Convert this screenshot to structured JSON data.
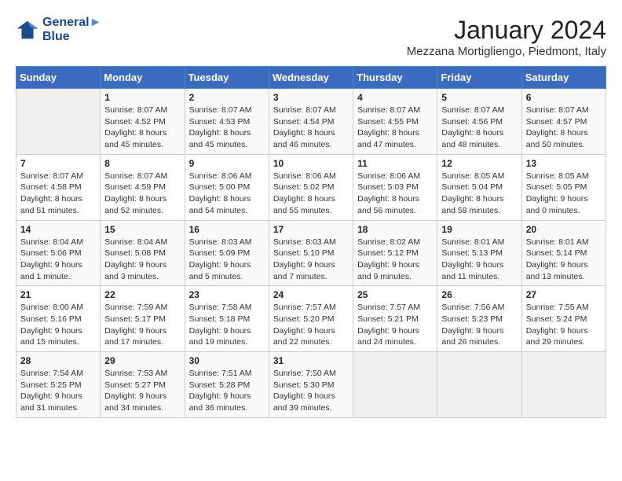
{
  "logo": {
    "line1": "General",
    "line2": "Blue"
  },
  "title": "January 2024",
  "location": "Mezzana Mortigliengo, Piedmont, Italy",
  "headers": [
    "Sunday",
    "Monday",
    "Tuesday",
    "Wednesday",
    "Thursday",
    "Friday",
    "Saturday"
  ],
  "weeks": [
    [
      {
        "day": "",
        "info": ""
      },
      {
        "day": "1",
        "info": "Sunrise: 8:07 AM\nSunset: 4:52 PM\nDaylight: 8 hours\nand 45 minutes."
      },
      {
        "day": "2",
        "info": "Sunrise: 8:07 AM\nSunset: 4:53 PM\nDaylight: 8 hours\nand 45 minutes."
      },
      {
        "day": "3",
        "info": "Sunrise: 8:07 AM\nSunset: 4:54 PM\nDaylight: 8 hours\nand 46 minutes."
      },
      {
        "day": "4",
        "info": "Sunrise: 8:07 AM\nSunset: 4:55 PM\nDaylight: 8 hours\nand 47 minutes."
      },
      {
        "day": "5",
        "info": "Sunrise: 8:07 AM\nSunset: 4:56 PM\nDaylight: 8 hours\nand 48 minutes."
      },
      {
        "day": "6",
        "info": "Sunrise: 8:07 AM\nSunset: 4:57 PM\nDaylight: 8 hours\nand 50 minutes."
      }
    ],
    [
      {
        "day": "7",
        "info": "Sunrise: 8:07 AM\nSunset: 4:58 PM\nDaylight: 8 hours\nand 51 minutes."
      },
      {
        "day": "8",
        "info": "Sunrise: 8:07 AM\nSunset: 4:59 PM\nDaylight: 8 hours\nand 52 minutes."
      },
      {
        "day": "9",
        "info": "Sunrise: 8:06 AM\nSunset: 5:00 PM\nDaylight: 8 hours\nand 54 minutes."
      },
      {
        "day": "10",
        "info": "Sunrise: 8:06 AM\nSunset: 5:02 PM\nDaylight: 8 hours\nand 55 minutes."
      },
      {
        "day": "11",
        "info": "Sunrise: 8:06 AM\nSunset: 5:03 PM\nDaylight: 8 hours\nand 56 minutes."
      },
      {
        "day": "12",
        "info": "Sunrise: 8:05 AM\nSunset: 5:04 PM\nDaylight: 8 hours\nand 58 minutes."
      },
      {
        "day": "13",
        "info": "Sunrise: 8:05 AM\nSunset: 5:05 PM\nDaylight: 9 hours\nand 0 minutes."
      }
    ],
    [
      {
        "day": "14",
        "info": "Sunrise: 8:04 AM\nSunset: 5:06 PM\nDaylight: 9 hours\nand 1 minute."
      },
      {
        "day": "15",
        "info": "Sunrise: 8:04 AM\nSunset: 5:08 PM\nDaylight: 9 hours\nand 3 minutes."
      },
      {
        "day": "16",
        "info": "Sunrise: 8:03 AM\nSunset: 5:09 PM\nDaylight: 9 hours\nand 5 minutes."
      },
      {
        "day": "17",
        "info": "Sunrise: 8:03 AM\nSunset: 5:10 PM\nDaylight: 9 hours\nand 7 minutes."
      },
      {
        "day": "18",
        "info": "Sunrise: 8:02 AM\nSunset: 5:12 PM\nDaylight: 9 hours\nand 9 minutes."
      },
      {
        "day": "19",
        "info": "Sunrise: 8:01 AM\nSunset: 5:13 PM\nDaylight: 9 hours\nand 11 minutes."
      },
      {
        "day": "20",
        "info": "Sunrise: 8:01 AM\nSunset: 5:14 PM\nDaylight: 9 hours\nand 13 minutes."
      }
    ],
    [
      {
        "day": "21",
        "info": "Sunrise: 8:00 AM\nSunset: 5:16 PM\nDaylight: 9 hours\nand 15 minutes."
      },
      {
        "day": "22",
        "info": "Sunrise: 7:59 AM\nSunset: 5:17 PM\nDaylight: 9 hours\nand 17 minutes."
      },
      {
        "day": "23",
        "info": "Sunrise: 7:58 AM\nSunset: 5:18 PM\nDaylight: 9 hours\nand 19 minutes."
      },
      {
        "day": "24",
        "info": "Sunrise: 7:57 AM\nSunset: 5:20 PM\nDaylight: 9 hours\nand 22 minutes."
      },
      {
        "day": "25",
        "info": "Sunrise: 7:57 AM\nSunset: 5:21 PM\nDaylight: 9 hours\nand 24 minutes."
      },
      {
        "day": "26",
        "info": "Sunrise: 7:56 AM\nSunset: 5:23 PM\nDaylight: 9 hours\nand 26 minutes."
      },
      {
        "day": "27",
        "info": "Sunrise: 7:55 AM\nSunset: 5:24 PM\nDaylight: 9 hours\nand 29 minutes."
      }
    ],
    [
      {
        "day": "28",
        "info": "Sunrise: 7:54 AM\nSunset: 5:25 PM\nDaylight: 9 hours\nand 31 minutes."
      },
      {
        "day": "29",
        "info": "Sunrise: 7:53 AM\nSunset: 5:27 PM\nDaylight: 9 hours\nand 34 minutes."
      },
      {
        "day": "30",
        "info": "Sunrise: 7:51 AM\nSunset: 5:28 PM\nDaylight: 9 hours\nand 36 minutes."
      },
      {
        "day": "31",
        "info": "Sunrise: 7:50 AM\nSunset: 5:30 PM\nDaylight: 9 hours\nand 39 minutes."
      },
      {
        "day": "",
        "info": ""
      },
      {
        "day": "",
        "info": ""
      },
      {
        "day": "",
        "info": ""
      }
    ]
  ]
}
